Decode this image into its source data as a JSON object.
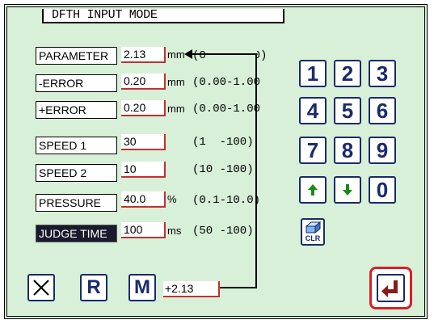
{
  "title": "DFTH INPUT MODE",
  "params": [
    {
      "label": "PARAMETER",
      "value": "2.13",
      "unit": "mm",
      "range": "(0.00-1.00)"
    },
    {
      "label": "-ERROR",
      "value": "0.20",
      "unit": "mm",
      "range": "(0.00-1.00)"
    },
    {
      "label": "+ERROR",
      "value": "0.20",
      "unit": "mm",
      "range": "(0.00-1.00)"
    },
    {
      "label": "SPEED 1",
      "value": "30",
      "unit": "",
      "range": "(1  -100)"
    },
    {
      "label": "SPEED 2",
      "value": "10",
      "unit": "",
      "range": "(10 -100)"
    },
    {
      "label": "PRESSURE",
      "value": "40.0",
      "unit": "%",
      "range": "(0.1-10.0)"
    },
    {
      "label": "JUDGE TIME",
      "value": "100",
      "unit": "ms",
      "range": "(50 -100)"
    }
  ],
  "keypad": {
    "keys": [
      "1",
      "2",
      "3",
      "4",
      "5",
      "6",
      "7",
      "8",
      "9",
      "0"
    ],
    "up_icon": "arrow-up-icon",
    "down_icon": "arrow-down-icon",
    "clear_label": "CLR"
  },
  "bottom": {
    "cancel_icon": "close-icon",
    "r_label": "R",
    "m_label": "M",
    "result_value": "+2.13"
  },
  "enter_icon": "enter-return-icon",
  "colors": {
    "background": "#d8f0d8",
    "key_border": "#1a2a6c",
    "accent_red": "#d8202a",
    "arrow_green": "#1a8a1a"
  }
}
